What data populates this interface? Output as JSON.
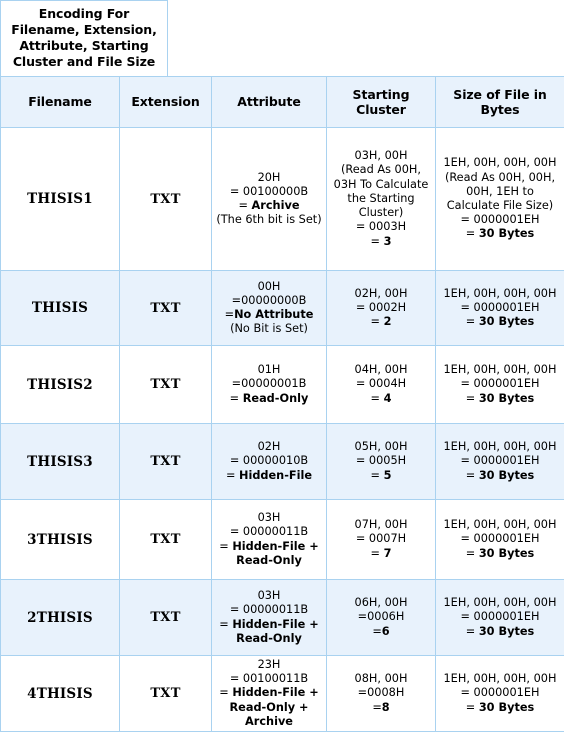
{
  "title": {
    "text": "Encoding For Filename, Extension, Attribute, Starting Cluster and File Size"
  },
  "table": {
    "headers": [
      "Filename",
      "Extension",
      "Attribute",
      "Starting Cluster",
      "Size of File in Bytes"
    ],
    "rows": [
      {
        "filename": "THISIS1",
        "extension": "TXT",
        "attribute_plain_1": "20H\n= 00100000B\n= ",
        "attribute_bold": "Archive",
        "attribute_plain_2": "\n(The 6th bit is Set)",
        "cluster_plain_1": "03H, 00H\n(Read As 00H, 03H To Calculate the Starting Cluster)\n= 0003H\n= ",
        "cluster_bold": "3",
        "size_plain_1": "1EH, 00H, 00H, 00H\n(Read As 00H, 00H, 00H, 1EH to Calculate File Size)\n= 0000001EH\n= ",
        "size_bold": "30 Bytes"
      },
      {
        "filename": "THISIS",
        "extension": "TXT",
        "attribute_plain_1": "00H\n=00000000B\n=",
        "attribute_bold": "No Attribute",
        "attribute_plain_2": "\n(No Bit is Set)",
        "cluster_plain_1": "02H, 00H\n= 0002H\n= ",
        "cluster_bold": "2",
        "size_plain_1": "1EH, 00H, 00H, 00H\n= 0000001EH\n= ",
        "size_bold": "30 Bytes"
      },
      {
        "filename": "THISIS2",
        "extension": "TXT",
        "attribute_plain_1": "01H\n=00000001B\n= ",
        "attribute_bold": "Read-Only",
        "attribute_plain_2": "",
        "cluster_plain_1": "04H, 00H\n= 0004H\n= ",
        "cluster_bold": "4",
        "size_plain_1": "1EH, 00H, 00H, 00H\n= 0000001EH\n= ",
        "size_bold": "30 Bytes"
      },
      {
        "filename": "THISIS3",
        "extension": "TXT",
        "attribute_plain_1": "02H\n= 00000010B\n= ",
        "attribute_bold": "Hidden-File",
        "attribute_plain_2": "",
        "cluster_plain_1": "05H, 00H\n= 0005H\n= ",
        "cluster_bold": "5",
        "size_plain_1": "1EH, 00H, 00H, 00H\n= 0000001EH\n= ",
        "size_bold": "30 Bytes"
      },
      {
        "filename": "3THISIS",
        "extension": "TXT",
        "attribute_plain_1": "03H\n= 00000011B\n= ",
        "attribute_bold": "Hidden-File + Read-Only",
        "attribute_plain_2": "",
        "cluster_plain_1": "07H, 00H\n= 0007H\n= ",
        "cluster_bold": "7",
        "size_plain_1": "1EH, 00H, 00H, 00H\n= 0000001EH\n= ",
        "size_bold": "30 Bytes"
      },
      {
        "filename": "2THISIS",
        "extension": "TXT",
        "attribute_plain_1": "03H\n= 00000011B\n= ",
        "attribute_bold": "Hidden-File + Read-Only",
        "attribute_plain_2": "",
        "cluster_plain_1": "06H, 00H\n=0006H\n=",
        "cluster_bold": "6",
        "size_plain_1": "1EH, 00H, 00H, 00H\n= 0000001EH\n= ",
        "size_bold": "30 Bytes"
      },
      {
        "filename": "4THISIS",
        "extension": "TXT",
        "attribute_plain_1": "23H\n= 00100011B\n= ",
        "attribute_bold": "Hidden-File + Read-Only + Archive",
        "attribute_plain_2": "",
        "cluster_plain_1": "08H, 00H\n=0008H\n=",
        "cluster_bold": "8",
        "size_plain_1": "1EH, 00H, 00H, 00H\n= 0000001EH\n= ",
        "size_bold": "30 Bytes"
      }
    ]
  },
  "colors": {
    "border": "#a9d2f0",
    "row_shade": "#e8f2fc",
    "row_plain": "#ffffff",
    "first_row_text": "#5a6572"
  }
}
